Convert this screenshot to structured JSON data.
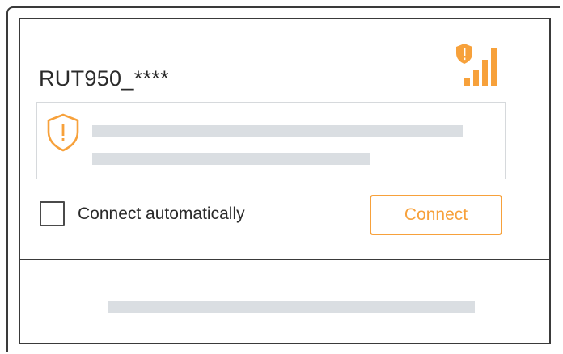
{
  "network": {
    "name": "RUT950_****",
    "security_icon": "shield-warning-icon",
    "signal_icon": "signal-bars-icon",
    "signal_strength": "4/4"
  },
  "warning": {
    "icon": "shield-warning-icon"
  },
  "options": {
    "auto_connect_label": "Connect automatically",
    "auto_connect_checked": false
  },
  "actions": {
    "connect_label": "Connect"
  },
  "colors": {
    "accent": "#f7a13b",
    "border": "#3a3a3a",
    "placeholder": "#dadee2"
  }
}
